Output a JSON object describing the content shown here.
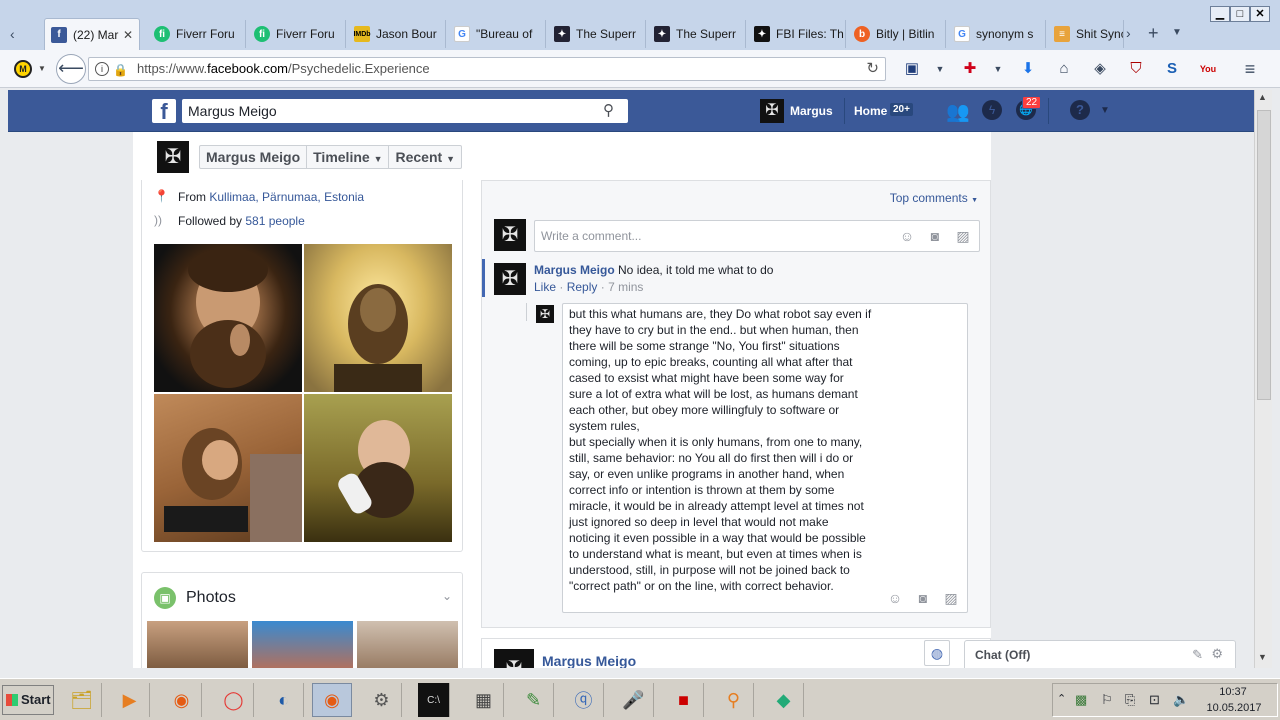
{
  "browser": {
    "tabs": [
      {
        "label": "(22) Mar",
        "icon": "facebook-icon",
        "active": true
      },
      {
        "label": "Fiverr Foru",
        "icon": "fiverr-icon"
      },
      {
        "label": "Fiverr Foru",
        "icon": "fiverr-icon"
      },
      {
        "label": "Jason Bour",
        "icon": "imdb-icon"
      },
      {
        "label": "\"Bureau of",
        "icon": "google-icon"
      },
      {
        "label": "The Superr",
        "icon": "superr-icon"
      },
      {
        "label": "The Superr",
        "icon": "superr-icon"
      },
      {
        "label": "FBI Files: Th",
        "icon": "fbi-icon"
      },
      {
        "label": "Bitly | Bitlin",
        "icon": "bitly-icon"
      },
      {
        "label": "synonym s",
        "icon": "google-icon"
      },
      {
        "label": "Shit Sync",
        "icon": "shit-icon"
      }
    ],
    "close_glyph": "✕",
    "url_prefix": "https://www.",
    "url_host": "facebook.com",
    "url_path": "/Psychedelic.Experience"
  },
  "fb": {
    "search_value": "Margus Meigo",
    "user_name": "Margus",
    "home_label": "Home",
    "home_count": "20+",
    "notifications_count": "22",
    "subnav": {
      "name": "Margus Meigo",
      "timeline": "Timeline",
      "recent": "Recent"
    },
    "intro": {
      "from_prefix": "From",
      "from_location": "Kullimaa, Pärnumaa, Estonia",
      "followed_prefix": "Followed by",
      "followed_count": "581 people"
    },
    "photos_title": "Photos",
    "comments": {
      "sort_label": "Top comments",
      "write_placeholder": "Write a comment...",
      "first": {
        "author": "Margus Meigo",
        "text": "No idea, it told me what to do",
        "like": "Like",
        "reply": "Reply",
        "time": "7 mins",
        "sep": "·"
      },
      "reply_lines": [
        "but this what humans are, they Do what robot say even if",
        "they have to cry but in the end.. but when human, then",
        "there will be some strange \"No, You first\" situations",
        "coming, up to epic breaks, counting all what after that",
        "cased to exsist what might have been some way for",
        "sure a lot of extra what will be lost, as humans demant",
        "each other, but obey more willingfuly to software or",
        "system rules,",
        "but specially when it is only humans, from one to many,",
        "still, same behavior:  no You all do first then will i do or",
        "say,  or even unlike programs in another hand, when",
        "correct info or intention is thrown at them by some",
        "miracle, it would be in already attempt level at times not",
        "just ignored so deep in level that would not make",
        "noticing it even possible in a way that would be possible",
        "to understand what is meant, but even at times when is",
        "understood, still, in purpose will not be joined back to",
        "\"correct path\" or on the line, with  correct behavior."
      ]
    },
    "next_post_author": "Margus Meigo",
    "chat_label": "Chat (Off)"
  },
  "taskbar": {
    "start_label": "Start",
    "clock_time": "10:37",
    "clock_date": "10.05.2017"
  },
  "colors": {
    "fb_blue": "#3b5998",
    "link": "#365899",
    "notif_red": "#fa3e3e"
  }
}
